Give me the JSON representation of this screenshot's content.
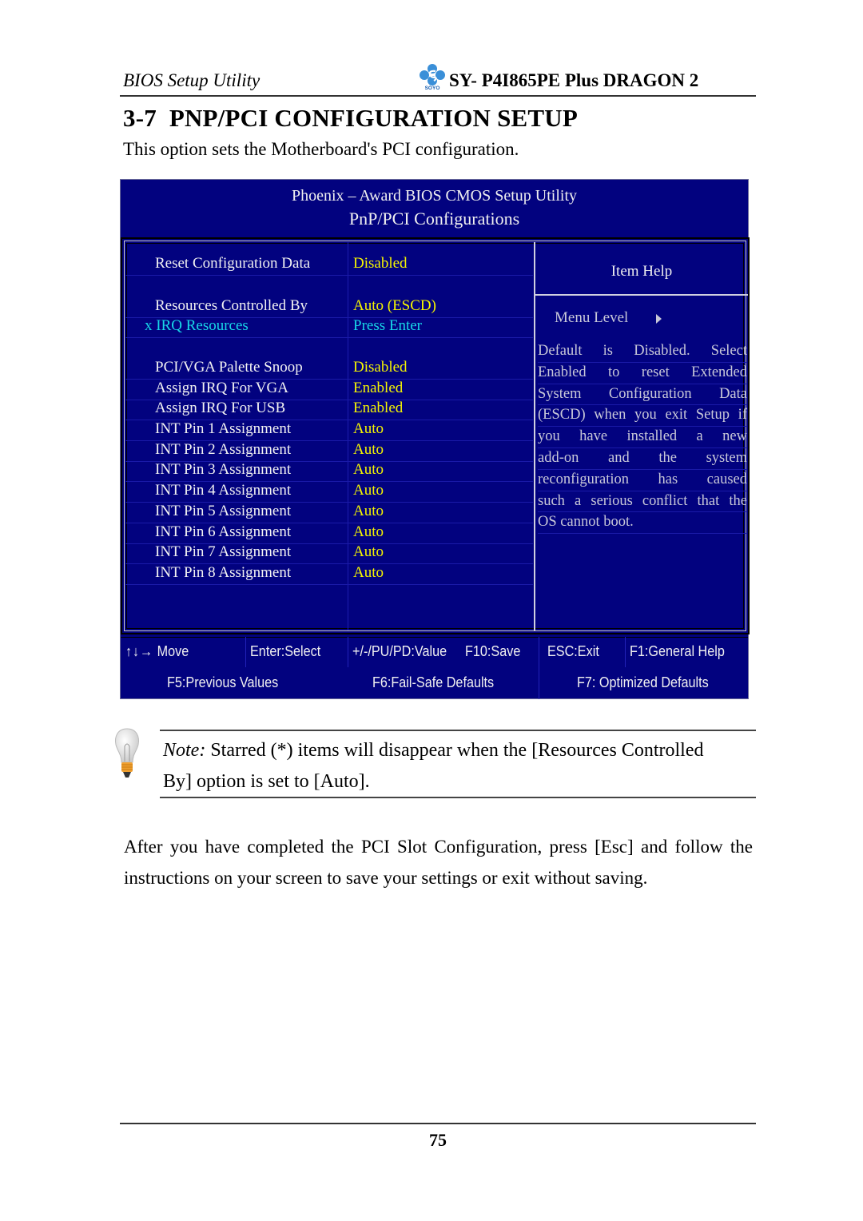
{
  "header": {
    "left": "BIOS Setup Utility",
    "logo": "soyo-logo-icon",
    "logo_text": "SOYO",
    "model": "SY- P4I865PE Plus DRAGON 2"
  },
  "section": {
    "title": "3-7  PNP/PCI CONFIGURATION SETUP",
    "intro": "This option sets the Motherboard's PCI configuration."
  },
  "bios": {
    "title": "Phoenix – Award BIOS CMOS Setup Utility",
    "subtitle": "PnP/PCI Configurations",
    "colors": {
      "background": "#02027f",
      "label": "#f2f2f2",
      "value": "#f5f500",
      "submenu": "#18d8e8",
      "help": "#c8c8d8"
    },
    "items": [
      {
        "label": "Reset Configuration Data",
        "value": "Disabled"
      },
      {
        "label": "Resources Controlled By",
        "value": "Auto (ESCD)"
      },
      {
        "label": "x IRQ Resources",
        "value": "Press Enter",
        "submenu": true
      },
      {
        "label": "PCI/VGA Palette Snoop",
        "value": "Disabled"
      },
      {
        "label": "Assign IRQ For VGA",
        "value": "Enabled"
      },
      {
        "label": "Assign IRQ For USB",
        "value": "Enabled"
      },
      {
        "label": "INT Pin 1 Assignment",
        "value": "Auto"
      },
      {
        "label": "INT Pin 2 Assignment",
        "value": "Auto"
      },
      {
        "label": "INT Pin 3 Assignment",
        "value": "Auto"
      },
      {
        "label": "INT Pin 4 Assignment",
        "value": "Auto"
      },
      {
        "label": "INT Pin 5 Assignment",
        "value": "Auto"
      },
      {
        "label": "INT Pin 6 Assignment",
        "value": "Auto"
      },
      {
        "label": "INT Pin 7 Assignment",
        "value": "Auto"
      },
      {
        "label": "INT Pin 8 Assignment",
        "value": "Auto"
      }
    ],
    "help": {
      "title": "Item Help",
      "menu_level": "Menu Level",
      "lines": [
        "Default is Disabled. Select",
        "Enabled to reset Extended",
        "System Configuration Data",
        "(ESCD) when you exit Setup if",
        "you have installed a new",
        "add-on and the system",
        "reconfiguration has caused",
        "such a serious conflict that the",
        "OS cannot boot."
      ]
    },
    "keys": {
      "move_arrows": "↑↓→",
      "move": "Move",
      "enter": "Enter:Select",
      "value": "+/-/PU/PD:Value",
      "save": "F10:Save",
      "exit": "ESC:Exit",
      "help": "F1:General Help",
      "previous": "F5:Previous Values",
      "failsafe": "F6:Fail-Safe Defaults",
      "optimized": "F7: Optimized Defaults"
    }
  },
  "note": {
    "icon": "lightbulb-icon",
    "label": "Note:",
    "line1": " Starred (*) items will disappear when the [Resources Controlled",
    "line2": "By] option is set to [Auto]."
  },
  "paragraph": "After you have completed the PCI Slot Configuration, press [Esc] and follow the instructions on your screen to save your settings or exit without saving.",
  "page_number": "75"
}
